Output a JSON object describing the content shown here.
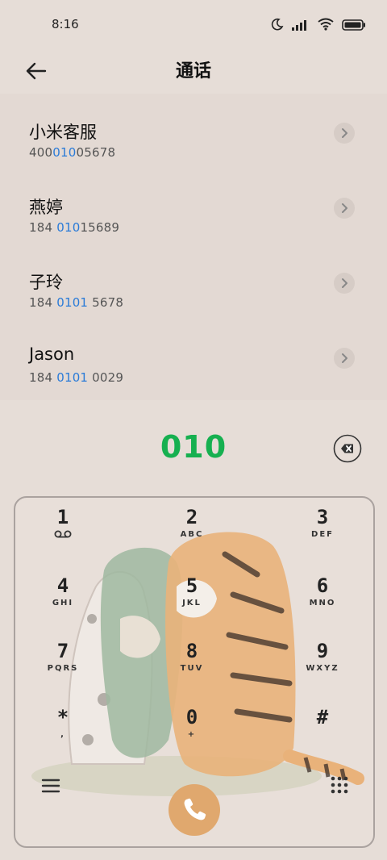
{
  "status_bar": {
    "time": "8:16",
    "icons": [
      "moon-icon",
      "signal-icon",
      "wifi-icon",
      "battery-icon"
    ]
  },
  "header": {
    "title": "通话",
    "back_icon": "back-arrow-icon"
  },
  "results": [
    {
      "name": "小米客服",
      "number_prefix": "400",
      "number_match": "010",
      "number_suffix": "05678"
    },
    {
      "name": "燕婷",
      "number_prefix": "184 ",
      "number_match": "010",
      "number_suffix": "15689"
    },
    {
      "name": "子玲",
      "number_prefix": "184 ",
      "number_match": "0101",
      "number_suffix": " 5678"
    },
    {
      "name": "Jason",
      "number_prefix": "184 ",
      "number_match": "0101",
      "number_suffix": " 0029"
    }
  ],
  "entry": {
    "value": "010",
    "color": "#16b050"
  },
  "keypad": {
    "keys": [
      {
        "digit": "1",
        "letters": ""
      },
      {
        "digit": "2",
        "letters": "ABC"
      },
      {
        "digit": "3",
        "letters": "DEF"
      },
      {
        "digit": "4",
        "letters": "GHI"
      },
      {
        "digit": "5",
        "letters": "JKL"
      },
      {
        "digit": "6",
        "letters": "MNO"
      },
      {
        "digit": "7",
        "letters": "PQRS"
      },
      {
        "digit": "8",
        "letters": "TUV"
      },
      {
        "digit": "9",
        "letters": "WXYZ"
      },
      {
        "digit": "*",
        "letters": ","
      },
      {
        "digit": "0",
        "letters": "+"
      },
      {
        "digit": "#",
        "letters": ""
      }
    ],
    "call_color": "#e0a86e",
    "highlight_color": "#2a7bd8"
  }
}
